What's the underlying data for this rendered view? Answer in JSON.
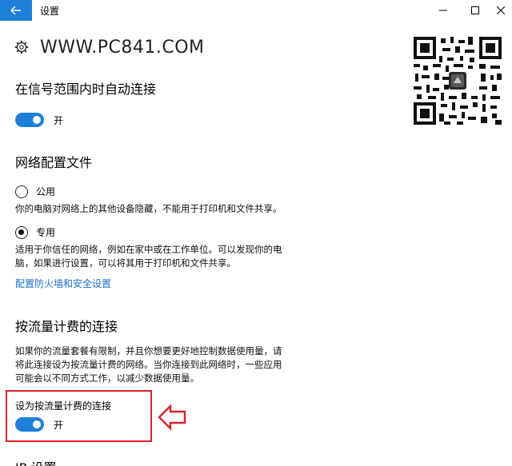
{
  "window": {
    "title": "设置",
    "back_icon": "back-arrow-icon",
    "min_icon": "minimize-icon",
    "max_icon": "maximize-icon",
    "close_icon": "close-icon"
  },
  "brand": {
    "icon": "gear-icon",
    "text": "WWW.PC841.COM"
  },
  "auto_connect": {
    "heading": "在信号范围内时自动连接",
    "toggle_label": "开",
    "on": true
  },
  "profile": {
    "heading": "网络配置文件",
    "public": {
      "label": "公用",
      "desc": "你的电脑对网络上的其他设备隐藏，不能用于打印机和文件共享。",
      "checked": false
    },
    "private": {
      "label": "专用",
      "desc1": "适用于你信任的网络，例如在家中或在工作单位。可以发现你的电",
      "desc2": "脑，如果进行设置，可以将其用于打印机和文件共享。",
      "checked": true
    },
    "firewall_link": "配置防火墙和安全设置"
  },
  "metered": {
    "heading": "按流量计费的连接",
    "desc1": "如果你的流量套餐有限制，并且你想要更好地控制数据使用量，请",
    "desc2": "将此连接设为按流量计费的网络。当你连接到此网络时，一些应用",
    "desc3": "可能会以不同方式工作，以减少数据使用量。",
    "set_label": "设为按流量计费的连接",
    "toggle_label": "开",
    "on": true
  },
  "ip_heading": "IP 设置",
  "colors": {
    "accent": "#1e7fd8",
    "highlight": "#d8232a",
    "link": "#1a6fc4"
  }
}
